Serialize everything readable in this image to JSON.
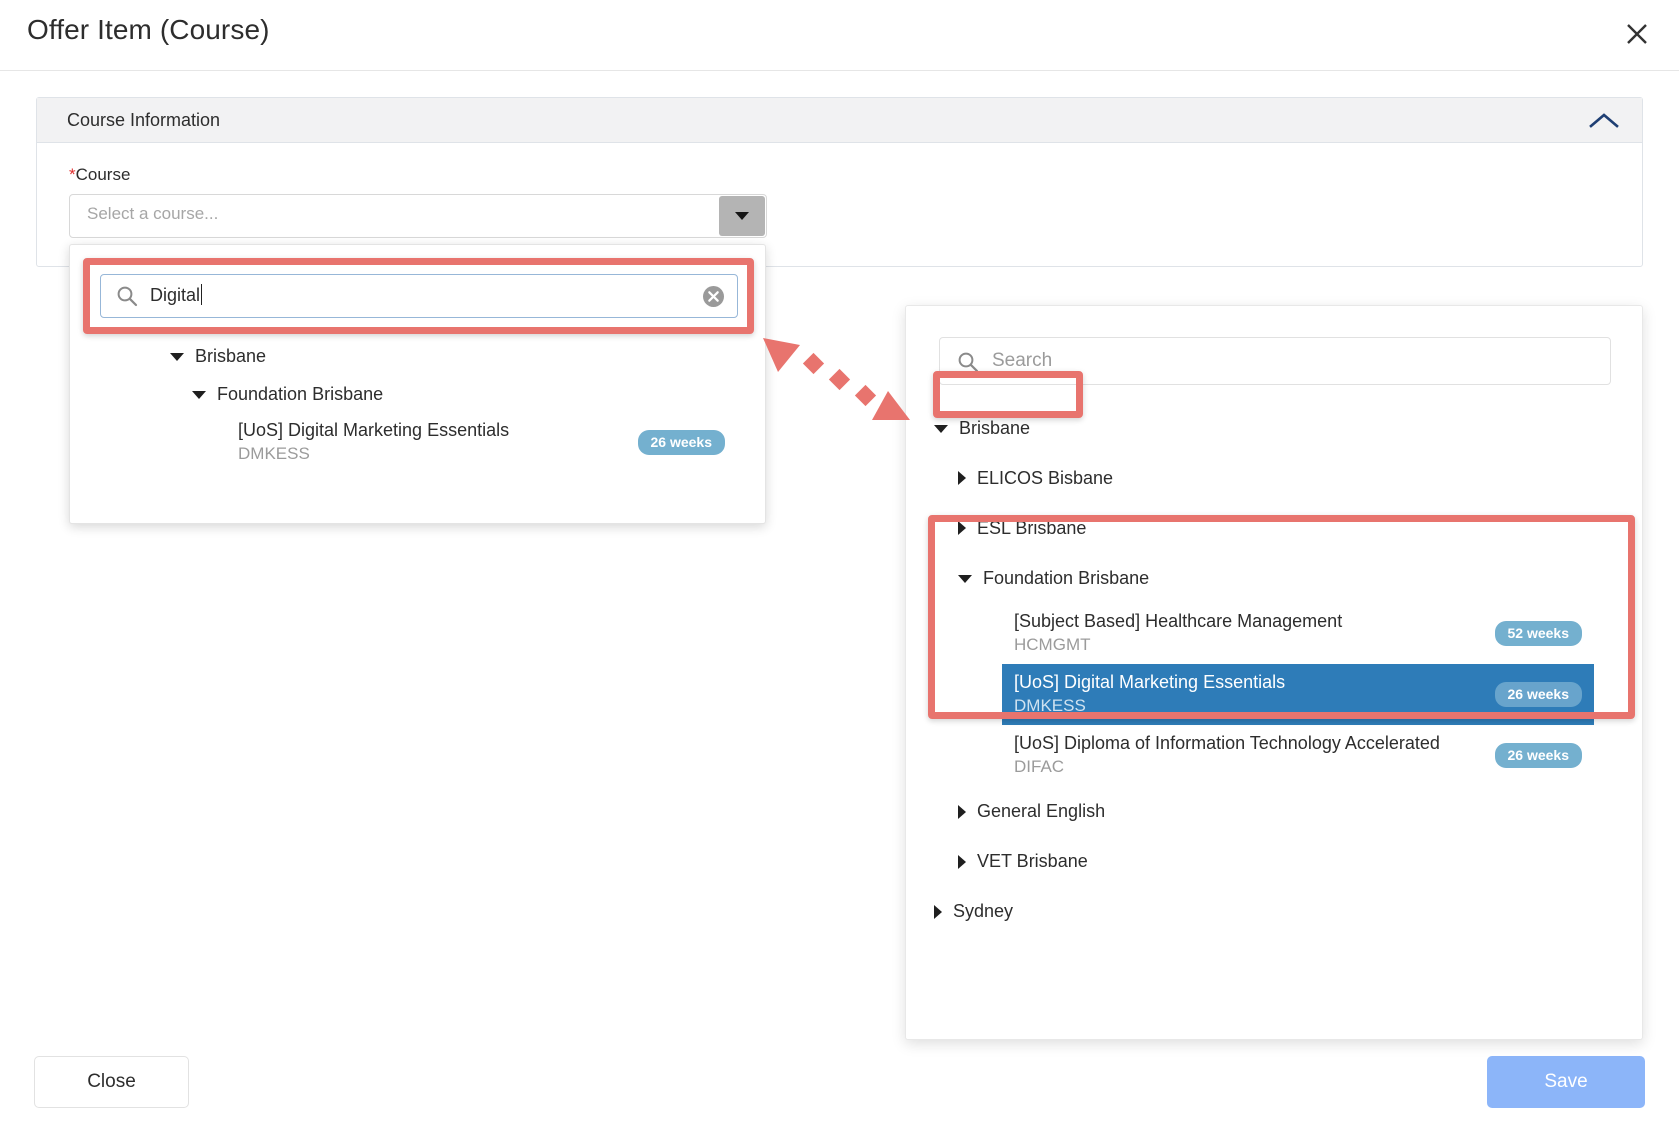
{
  "modal": {
    "title": "Offer Item (Course)",
    "close_icon": "close-icon"
  },
  "card": {
    "header_title": "Course Information",
    "collapse_icon": "chevron-up-icon"
  },
  "course_field": {
    "label": "Course",
    "required_marker": "*",
    "placeholder": "Select a course...",
    "dropdown_arrow_icon": "caret-down-icon"
  },
  "dropdown": {
    "search": {
      "value": "Digital",
      "search_icon": "search-icon",
      "clear_icon": "clear-circle-icon"
    },
    "tree": [
      {
        "label": "Brisbane",
        "level": 1,
        "expanded": true
      },
      {
        "label": "Foundation Brisbane",
        "level": 2,
        "expanded": true
      }
    ],
    "results": [
      {
        "title": "[UoS] Digital Marketing Essentials",
        "code": "DMKESS",
        "badge": "26 weeks"
      }
    ]
  },
  "right_panel": {
    "search": {
      "placeholder": "Search",
      "search_icon": "search-icon"
    },
    "nodes": {
      "brisbane": "Brisbane",
      "elicos": "ELICOS Bisbane",
      "esl": "ESL Brisbane",
      "foundation": "Foundation Brisbane",
      "general_english": "General English",
      "vet": "VET Brisbane",
      "sydney": "Sydney"
    },
    "courses": [
      {
        "title": "[Subject Based] Healthcare Management",
        "code": "HCMGMT",
        "badge": "52 weeks",
        "selected": false
      },
      {
        "title": "[UoS] Digital Marketing Essentials",
        "code": "DMKESS",
        "badge": "26 weeks",
        "selected": true
      },
      {
        "title": "[UoS] Diploma of Information Technology Accelerated",
        "code": "DIFAC",
        "badge": "26 weeks",
        "selected": false
      }
    ]
  },
  "footer": {
    "close_label": "Close",
    "save_label": "Save"
  },
  "colors": {
    "highlight": "#e8746e",
    "selected_row": "#2e7cb8",
    "badge": "#74b0cf",
    "save_button": "#8cb5f9",
    "required_star": "#e03030",
    "collapse_chevron": "#1f3f73"
  }
}
